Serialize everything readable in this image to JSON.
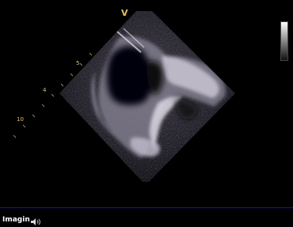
{
  "scan": {
    "orientation_marker": "V",
    "depth_labels": [
      {
        "text": "5"
      },
      {
        "text": "4"
      },
      {
        "text": "10"
      }
    ],
    "overlay_color": "#e8c341"
  },
  "grayscale_bar": {
    "top_color": "#ffffff",
    "bottom_color": "#101010"
  },
  "status_bar": {
    "mode_label": "Imagin",
    "audio_icon": "speaker-waves-icon"
  }
}
